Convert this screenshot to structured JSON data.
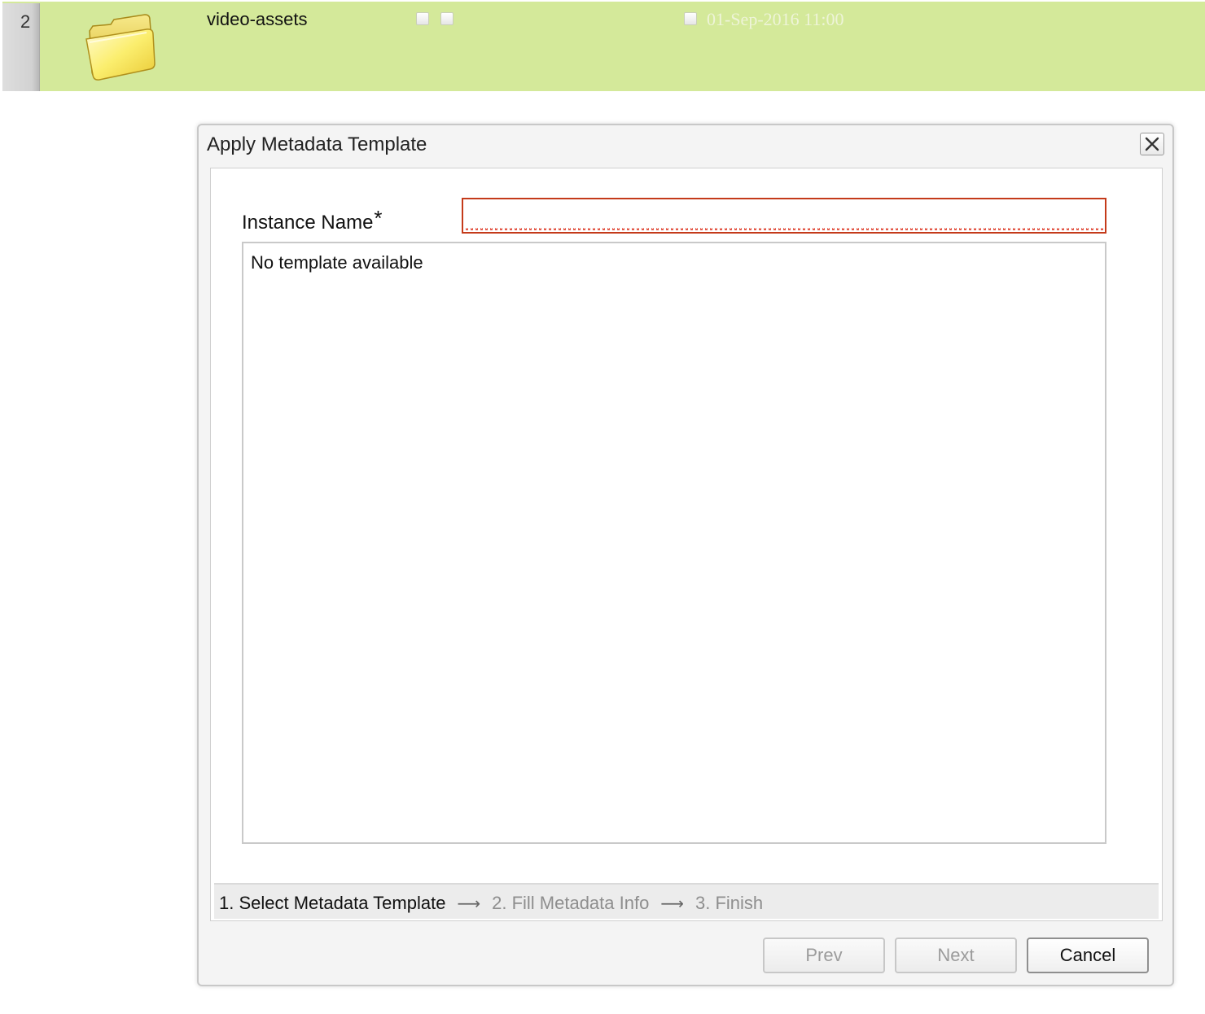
{
  "list_row": {
    "number": "2",
    "name": "video-assets",
    "modified": "01-Sep-2016 11:00",
    "icon": "folder-icon",
    "highlight_color": "#d4e99a"
  },
  "dialog": {
    "title": "Apply Metadata Template",
    "close_icon": "close-icon",
    "instance_label": "Instance Name",
    "required_marker": "*",
    "instance_value": "",
    "instance_placeholder": "",
    "template_message": "No template available",
    "steps": [
      {
        "label": "1. Select Metadata Template",
        "active": true
      },
      {
        "label": "2. Fill Metadata Info",
        "active": false
      },
      {
        "label": "3. Finish",
        "active": false
      }
    ],
    "step_separator": "⟶",
    "buttons": {
      "prev": "Prev",
      "next": "Next",
      "cancel": "Cancel"
    },
    "error_color": "#c43a1a"
  }
}
